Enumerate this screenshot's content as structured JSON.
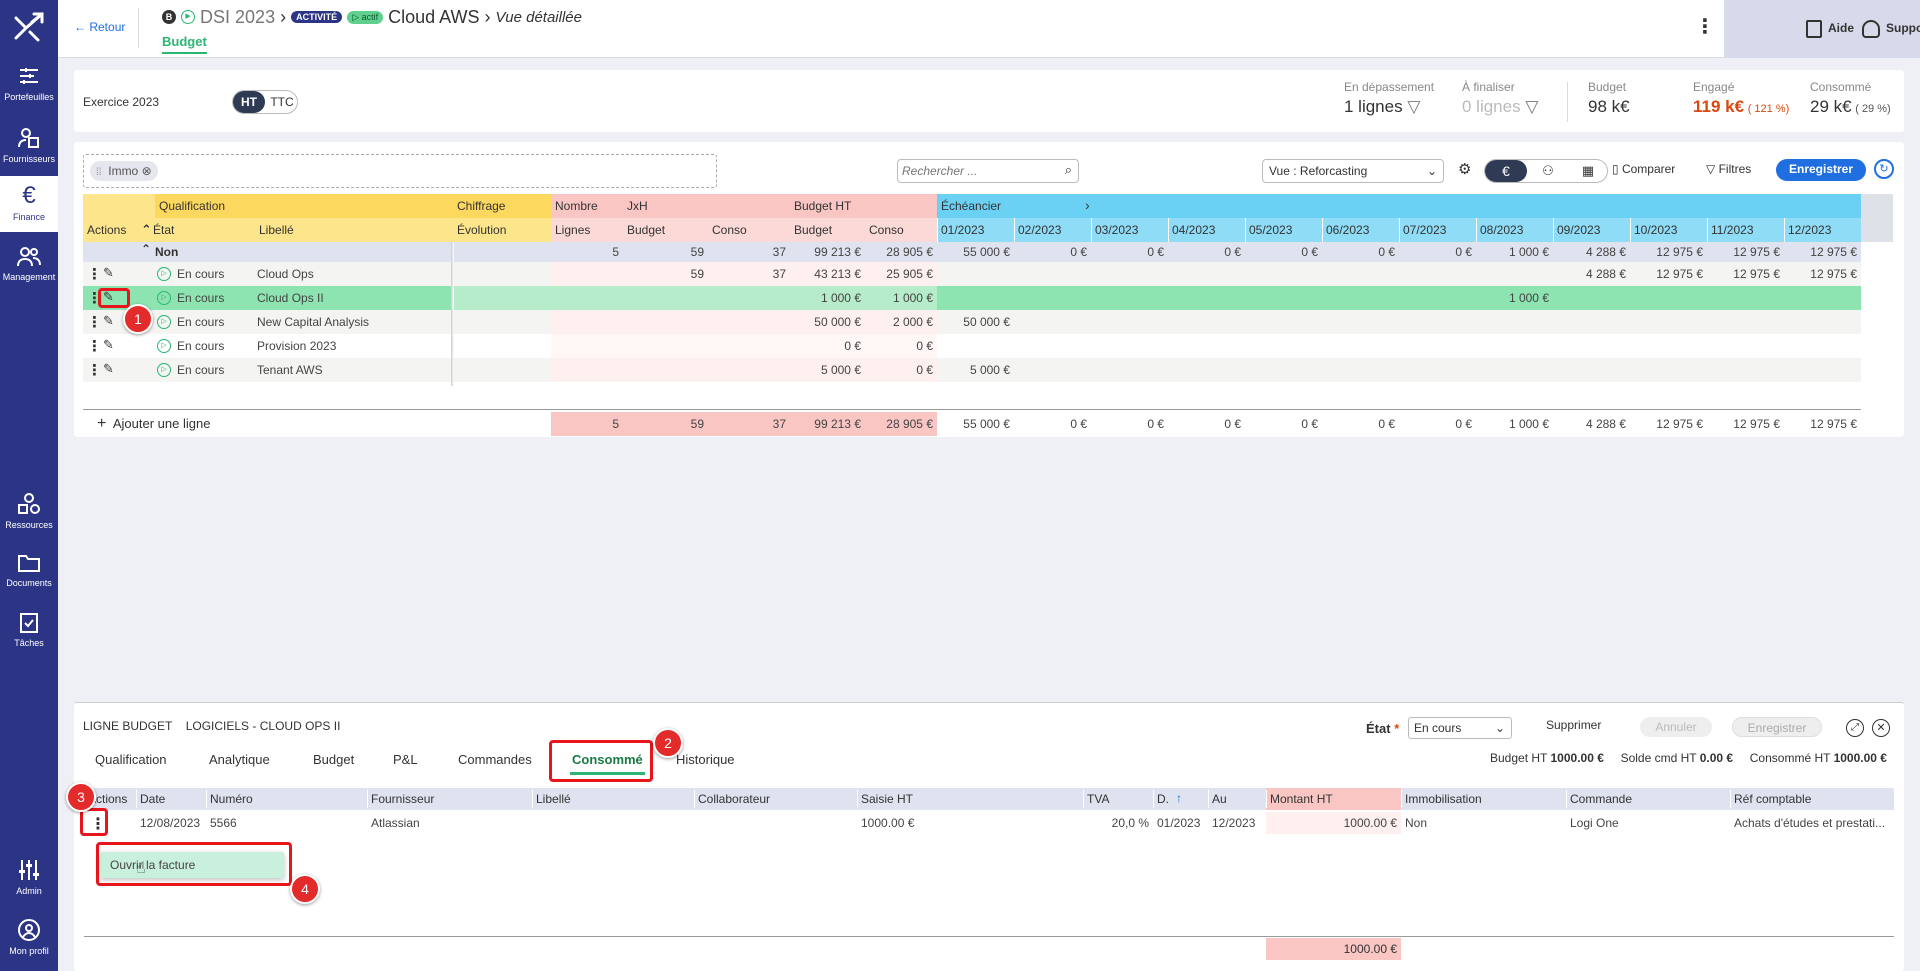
{
  "sidebar": {
    "items": [
      {
        "label": "Portefeuilles",
        "icon": "portfolio-icon"
      },
      {
        "label": "Fournisseurs",
        "icon": "suppliers-icon"
      },
      {
        "label": "Finance",
        "icon": "euro-icon"
      },
      {
        "label": "Management",
        "icon": "people-icon"
      },
      {
        "label": "Ressources",
        "icon": "shapes-icon"
      },
      {
        "label": "Documents",
        "icon": "folder-icon"
      },
      {
        "label": "Tâches",
        "icon": "tasks-icon"
      },
      {
        "label": "Admin",
        "icon": "sliders-icon"
      },
      {
        "label": "Mon profil",
        "icon": "user-circle-icon"
      }
    ]
  },
  "header": {
    "back": "Retour",
    "badge_b": "B",
    "portfolio": "DSI 2023",
    "badge_activity": "ACTIVITÉ",
    "badge_actif": "actif",
    "title": "Cloud AWS",
    "view": "Vue détaillée",
    "tab": "Budget",
    "aide": "Aide",
    "support": "Support"
  },
  "exercise": {
    "label": "Exercice 2023",
    "ht": "HT",
    "ttc": "TTC"
  },
  "kpis": {
    "depassement_label": "En dépassement",
    "depassement_value": "1 lignes",
    "finaliser_label": "À finaliser",
    "finaliser_value": "0 lignes",
    "budget_label": "Budget",
    "budget_value": "98 k€",
    "engage_label": "Engagé",
    "engage_value": "119 k€",
    "engage_pct": "( 121 %)",
    "consomme_label": "Consommé",
    "consomme_value": "29 k€",
    "consomme_pct": "( 29 %)"
  },
  "toolbar": {
    "chip": "Immo",
    "search_placeholder": "Rechercher ...",
    "view_select": "Vue : Reforcasting",
    "compare": "Comparer",
    "filters": "Filtres",
    "save": "Enregistrer"
  },
  "grid": {
    "groups": {
      "qualification": "Qualification",
      "chiffrage": "Chiffrage",
      "nombre": "Nombre",
      "jxh": "JxH",
      "budget_ht": "Budget HT",
      "echeancier": "Échéancier"
    },
    "cols": {
      "actions": "Actions",
      "etat": "État",
      "libelle": "Libellé",
      "evolution": "Évolution",
      "lignes": "Lignes",
      "budget": "Budget",
      "conso": "Conso",
      "budget2": "Budget",
      "conso2": "Conso"
    },
    "months": [
      "01/2023",
      "02/2023",
      "03/2023",
      "04/2023",
      "05/2023",
      "06/2023",
      "07/2023",
      "08/2023",
      "09/2023",
      "10/2023",
      "11/2023",
      "12/2023"
    ],
    "group_row": {
      "label": "Non",
      "lignes": "5",
      "jxh_budget": "59",
      "jxh_conso": "37",
      "budget": "99 213 €",
      "conso": "28 905 €",
      "months": [
        "55 000 €",
        "0 €",
        "0 €",
        "0 €",
        "0 €",
        "0 €",
        "0 €",
        "1 000 €",
        "4 288 €",
        "12 975 €",
        "12 975 €",
        "12 975 €"
      ]
    },
    "rows": [
      {
        "etat": "En cours",
        "libelle": "Cloud Ops",
        "lignes": "",
        "jxh_budget": "59",
        "jxh_conso": "37",
        "budget": "43 213 €",
        "conso": "25 905 €",
        "months": [
          "",
          "",
          "",
          "",
          "",
          "",
          "",
          "",
          "4 288 €",
          "12 975 €",
          "12 975 €",
          "12 975 €"
        ]
      },
      {
        "etat": "En cours",
        "libelle": "Cloud Ops II",
        "lignes": "",
        "jxh_budget": "",
        "jxh_conso": "",
        "budget": "1 000 €",
        "conso": "1 000 €",
        "months": [
          "",
          "",
          "",
          "",
          "",
          "",
          "",
          "1 000 €",
          "",
          "",
          "",
          ""
        ]
      },
      {
        "etat": "En cours",
        "libelle": "New Capital Analysis",
        "lignes": "",
        "jxh_budget": "",
        "jxh_conso": "",
        "budget": "50 000 €",
        "conso": "2 000 €",
        "months": [
          "50 000 €",
          "",
          "",
          "",
          "",
          "",
          "",
          "",
          "",
          "",
          "",
          ""
        ]
      },
      {
        "etat": "En cours",
        "libelle": "Provision 2023",
        "lignes": "",
        "jxh_budget": "",
        "jxh_conso": "",
        "budget": "0 €",
        "conso": "0 €",
        "months": [
          "",
          "",
          "",
          "",
          "",
          "",
          "",
          "",
          "",
          "",
          "",
          ""
        ]
      },
      {
        "etat": "En cours",
        "libelle": "Tenant AWS",
        "lignes": "",
        "jxh_budget": "",
        "jxh_conso": "",
        "budget": "5 000 €",
        "conso": "0 €",
        "months": [
          "5 000 €",
          "",
          "",
          "",
          "",
          "",
          "",
          "",
          "",
          "",
          "",
          ""
        ]
      }
    ],
    "add_row": "Ajouter une ligne",
    "totals": {
      "lignes": "5",
      "jxh_budget": "59",
      "jxh_conso": "37",
      "budget": "99 213 €",
      "conso": "28 905 €",
      "months": [
        "55 000 €",
        "0 €",
        "0 €",
        "0 €",
        "0 €",
        "0 €",
        "0 €",
        "1 000 €",
        "4 288 €",
        "12 975 €",
        "12 975 €",
        "12 975 €"
      ]
    }
  },
  "detail": {
    "title_prefix": "LIGNE BUDGET",
    "title": "LOGICIELS - CLOUD OPS II",
    "etat_label": "État",
    "etat_required": "*",
    "etat_value": "En cours",
    "delete": "Supprimer",
    "cancel": "Annuler",
    "save": "Enregistrer",
    "tabs": [
      "Qualification",
      "Analytique",
      "Budget",
      "P&L",
      "Commandes",
      "Consommé",
      "Historique"
    ],
    "summary": {
      "budget_label": "Budget HT",
      "budget_value": "1000.00 €",
      "solde_label": "Solde cmd HT",
      "solde_value": "0.00 €",
      "conso_label": "Consommé HT",
      "conso_value": "1000.00 €"
    },
    "cols": [
      "Actions",
      "Date",
      "Numéro",
      "Fournisseur",
      "Libellé",
      "Collaborateur",
      "Saisie HT",
      "TVA",
      "D.",
      "Au",
      "Montant HT",
      "Immobilisation",
      "Commande",
      "Réf comptable"
    ],
    "sort_arrow": "↑",
    "row": {
      "date": "12/08/2023",
      "numero": "5566",
      "fournisseur": "Atlassian",
      "libelle": "",
      "collaborateur": "",
      "saisie": "1000.00 €",
      "tva": "20,0 %",
      "du": "01/2023",
      "au": "12/2023",
      "montant": "1000.00 €",
      "immo": "Non",
      "commande": "Logi One",
      "ref": "Achats d'études et prestati..."
    },
    "menu_item": "Ouvrir la facture",
    "total": "1000.00 €"
  },
  "annotations": [
    "1",
    "2",
    "3",
    "4"
  ],
  "colors": {
    "sidebar": "#2c3585",
    "accent": "#1f6fe0",
    "green_row": "#8de4b0",
    "echeancier": "#6ad1f4",
    "qualif": "#fcd85e",
    "pink": "#f9c6c4"
  }
}
